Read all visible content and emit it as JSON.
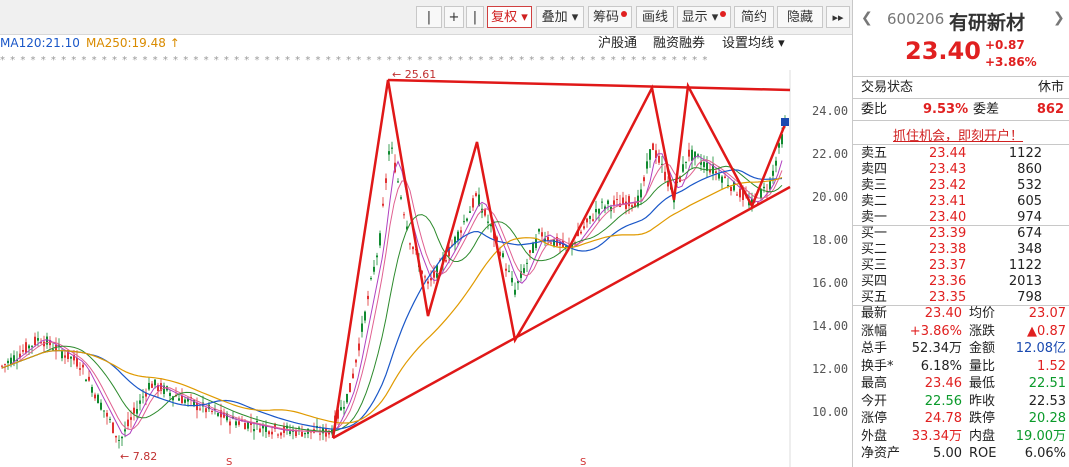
{
  "toolbar": {
    "buttons": [
      "复权",
      "叠加",
      "筹码",
      "画线",
      "显示",
      "简约",
      "隐藏"
    ],
    "plus": "+",
    "minus": "|",
    "nav": "▸▸"
  },
  "ma": {
    "ma120": "MA120:21.10",
    "ma250": "MA250:19.48",
    "arrow": "↑"
  },
  "links": [
    "沪股通",
    "融资融券",
    "设置均线"
  ],
  "chart": {
    "yticks": [
      "24.00",
      "22.00",
      "20.00",
      "18.00",
      "16.00",
      "14.00",
      "12.00",
      "10.00"
    ],
    "high_label": "25.61",
    "low_label": "7.82",
    "marker": "S"
  },
  "stock": {
    "code": "600206",
    "name": "有研新材",
    "price": "23.40",
    "change": "+0.87",
    "change_pct": "+3.86%",
    "status_label": "交易状态",
    "status_value": "休市",
    "weibi_label": "委比",
    "weibi_value": "9.53%",
    "weicha_label": "委差",
    "weicha_value": "862",
    "promo": "抓住机会，即刻开户！",
    "sell": [
      {
        "label": "卖五",
        "price": "23.44",
        "vol": "1122"
      },
      {
        "label": "卖四",
        "price": "23.43",
        "vol": "860"
      },
      {
        "label": "卖三",
        "price": "23.42",
        "vol": "532"
      },
      {
        "label": "卖二",
        "price": "23.41",
        "vol": "605"
      },
      {
        "label": "卖一",
        "price": "23.40",
        "vol": "974"
      }
    ],
    "buy": [
      {
        "label": "买一",
        "price": "23.39",
        "vol": "674"
      },
      {
        "label": "买二",
        "price": "23.38",
        "vol": "348"
      },
      {
        "label": "买三",
        "price": "23.37",
        "vol": "1122"
      },
      {
        "label": "买四",
        "price": "23.36",
        "vol": "2013"
      },
      {
        "label": "买五",
        "price": "23.35",
        "vol": "798"
      }
    ],
    "stats": [
      {
        "l1": "最新",
        "v1": "23.40",
        "c1": "red",
        "l2": "均价",
        "v2": "23.07",
        "c2": "red"
      },
      {
        "l1": "涨幅",
        "v1": "+3.86%",
        "c1": "red",
        "l2": "涨跌",
        "v2": "▲0.87",
        "c2": "red"
      },
      {
        "l1": "总手",
        "v1": "52.34万",
        "c1": "",
        "l2": "金额",
        "v2": "12.08亿",
        "c2": "blue"
      },
      {
        "l1": "换手*",
        "v1": "6.18%",
        "c1": "",
        "l2": "量比",
        "v2": "1.52",
        "c2": "red"
      },
      {
        "l1": "最高",
        "v1": "23.46",
        "c1": "red",
        "l2": "最低",
        "v2": "22.51",
        "c2": "green"
      },
      {
        "l1": "今开",
        "v1": "22.56",
        "c1": "green",
        "l2": "昨收",
        "v2": "22.53",
        "c2": ""
      },
      {
        "l1": "涨停",
        "v1": "24.78",
        "c1": "red",
        "l2": "跌停",
        "v2": "20.28",
        "c2": "green"
      },
      {
        "l1": "外盘",
        "v1": "33.34万",
        "c1": "red",
        "l2": "内盘",
        "v2": "19.00万",
        "c2": "green"
      },
      {
        "l1": "净资产",
        "v1": "5.00",
        "c1": "",
        "l2": "ROE",
        "v2": "6.06%",
        "c2": ""
      }
    ]
  }
}
